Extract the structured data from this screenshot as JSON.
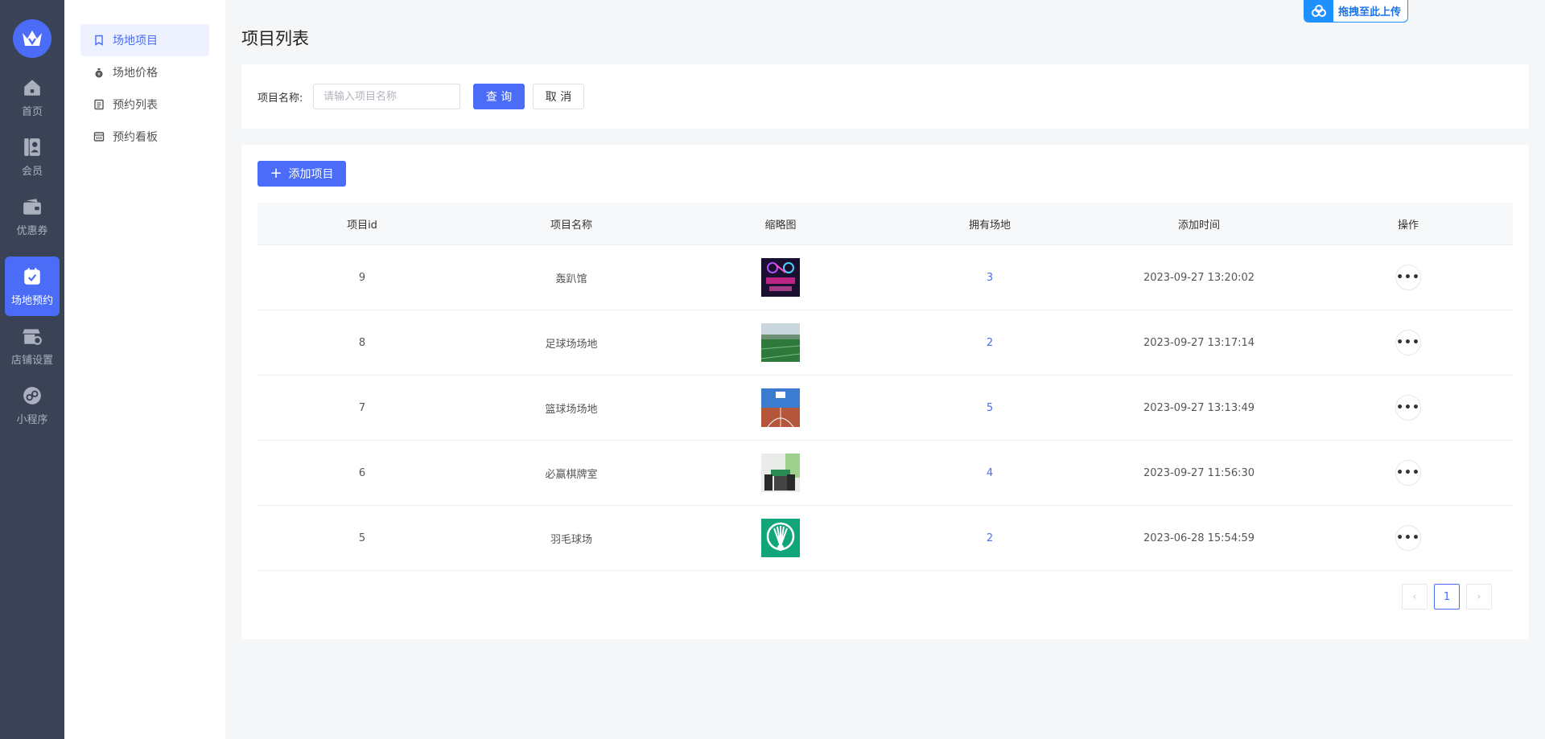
{
  "rail": {
    "items": [
      {
        "label": "首页",
        "icon": "home-icon"
      },
      {
        "label": "会员",
        "icon": "member-icon"
      },
      {
        "label": "优惠券",
        "icon": "coupon-icon"
      },
      {
        "label": "场地预约",
        "icon": "calendar-check-icon",
        "active": true
      },
      {
        "label": "店铺设置",
        "icon": "store-settings-icon"
      },
      {
        "label": "小程序",
        "icon": "mini-program-icon"
      }
    ]
  },
  "subnav": {
    "items": [
      {
        "label": "场地项目",
        "icon": "bookmark-icon",
        "active": true
      },
      {
        "label": "场地价格",
        "icon": "money-bag-icon"
      },
      {
        "label": "预约列表",
        "icon": "list-doc-icon"
      },
      {
        "label": "预约看板",
        "icon": "board-icon"
      }
    ]
  },
  "page": {
    "title": "项目列表"
  },
  "upload_badge": {
    "label": "拖拽至此上传"
  },
  "search": {
    "label": "项目名称:",
    "placeholder": "请输入项目名称",
    "query_label": "查 询",
    "cancel_label": "取 消"
  },
  "toolbar": {
    "add_label": "添加项目"
  },
  "table": {
    "columns": [
      "项目id",
      "项目名称",
      "缩略图",
      "拥有场地",
      "添加时间",
      "操作"
    ],
    "rows": [
      {
        "id": "9",
        "name": "轰趴馆",
        "thumb": "party-hall",
        "venues": "3",
        "time": "2023-09-27 13:20:02"
      },
      {
        "id": "8",
        "name": "足球场场地",
        "thumb": "football-field",
        "venues": "2",
        "time": "2023-09-27 13:17:14"
      },
      {
        "id": "7",
        "name": "篮球场场地",
        "thumb": "basketball-court",
        "venues": "5",
        "time": "2023-09-27 13:13:49"
      },
      {
        "id": "6",
        "name": "必赢棋牌室",
        "thumb": "chess-room",
        "venues": "4",
        "time": "2023-09-27 11:56:30"
      },
      {
        "id": "5",
        "name": "羽毛球场",
        "thumb": "badminton",
        "venues": "2",
        "time": "2023-06-28 15:54:59"
      }
    ]
  },
  "pagination": {
    "current": "1",
    "prev": "‹",
    "next": "›"
  },
  "colors": {
    "accent": "#4a6cf7",
    "rail_bg": "#3a4256",
    "page_bg": "#f5f6f8"
  }
}
